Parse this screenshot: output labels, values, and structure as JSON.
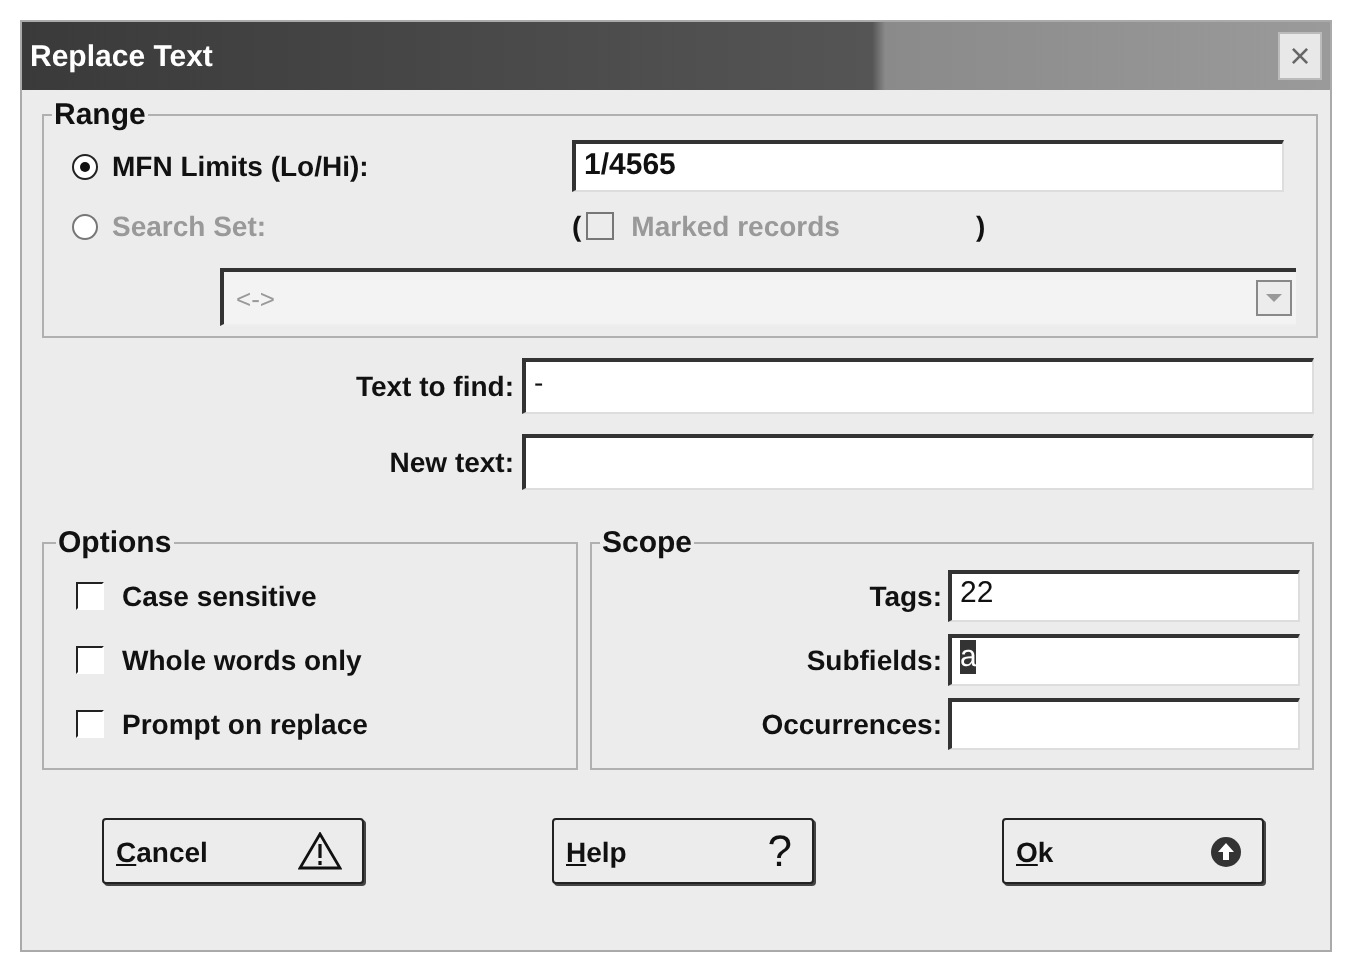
{
  "window": {
    "title": "Replace Text",
    "close": "×"
  },
  "range": {
    "title": "Range",
    "options": [
      {
        "label": "MFN Limits (Lo/Hi):",
        "selected": true,
        "disabled": false,
        "value": "1/4565"
      },
      {
        "label": "Search Set:",
        "selected": false,
        "disabled": true
      }
    ],
    "marked": {
      "open": "(",
      "label": "Marked records",
      "close": ")",
      "checked": false,
      "disabled": true
    },
    "set_dropdown": {
      "value": "<->",
      "disabled": true
    }
  },
  "find": {
    "label": "Text to find:",
    "value": "-"
  },
  "replace": {
    "label": "New text:"
  },
  "options": {
    "title": "Options",
    "items": [
      {
        "label": "Case sensitive",
        "checked": false
      },
      {
        "label": "Whole words only",
        "checked": false
      },
      {
        "label": "Prompt on replace",
        "checked": false
      }
    ]
  },
  "scope": {
    "title": "Scope",
    "fields": [
      {
        "label": "Tags:",
        "value": "22"
      },
      {
        "label": "Subfields:",
        "value": "a",
        "text_selected": true
      },
      {
        "label": "Occurrences:"
      }
    ]
  },
  "buttons": [
    {
      "label": "Cancel",
      "kind": "warning"
    },
    {
      "label": "Help",
      "kind": "help",
      "glyph": "?"
    },
    {
      "label": "Ok",
      "kind": "ok"
    }
  ]
}
